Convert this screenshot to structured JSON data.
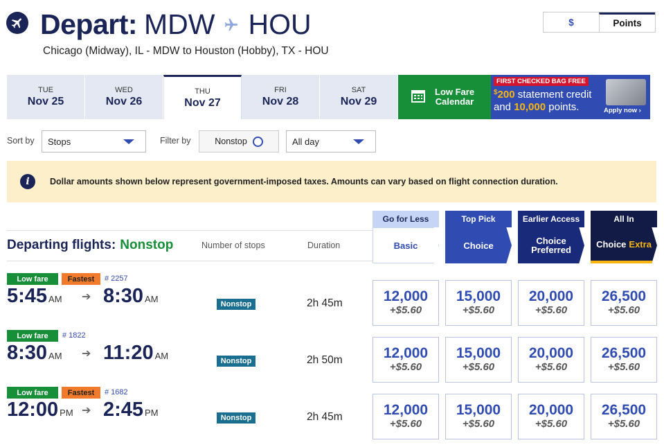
{
  "header": {
    "title_prefix": "Depart:",
    "origin": "MDW",
    "destination": "HOU",
    "route": "Chicago (Midway), IL - MDW to Houston (Hobby), TX - HOU",
    "currency_toggle": {
      "usd": "$",
      "points": "Points",
      "selected": "Points"
    }
  },
  "dates": [
    {
      "dow": "TUE",
      "day": "Nov 25",
      "active": false
    },
    {
      "dow": "WED",
      "day": "Nov 26",
      "active": false
    },
    {
      "dow": "THU",
      "day": "Nov 27",
      "active": true
    },
    {
      "dow": "FRI",
      "day": "Nov 28",
      "active": false
    },
    {
      "dow": "SAT",
      "day": "Nov 29",
      "active": false
    }
  ],
  "low_fare_calendar": {
    "line1": "Low Fare",
    "line2": "Calendar"
  },
  "promo": {
    "tag": "FIRST CHECKED BAG FREE",
    "dollar": "$",
    "amount1": "200",
    "line1_rest": " statement credit",
    "line2_pre": "and ",
    "amount2": "10,000",
    "line2_rest": " points.",
    "apply": "Apply now ›"
  },
  "controls": {
    "sort_label": "Sort by",
    "sort_value": "Stops",
    "filter_label": "Filter by",
    "nonstop_label": "Nonstop",
    "time_value": "All day"
  },
  "info": {
    "icon": "i",
    "text": "Dollar amounts shown below represent government-imposed taxes. Amounts can vary based on flight connection duration."
  },
  "list_header": {
    "title": "Departing flights:",
    "filter": "Nonstop",
    "col_stops": "Number of stops",
    "col_duration": "Duration"
  },
  "fare_families": [
    {
      "top": "Go for Less",
      "bottom": "Basic",
      "bottom_extra": ""
    },
    {
      "top": "Top Pick",
      "bottom": "Choice",
      "bottom_extra": ""
    },
    {
      "top": "Earlier Access",
      "bottom": "Choice Preferred",
      "bottom_extra": ""
    },
    {
      "top": "All In",
      "bottom": "Choice",
      "bottom_extra": "Extra"
    }
  ],
  "flights": [
    {
      "badges": [
        "Low fare",
        "Fastest"
      ],
      "flight_no": "# 2257",
      "depart": "5:45",
      "depart_ap": "AM",
      "arrive": "8:30",
      "arrive_ap": "AM",
      "stops": "Nonstop",
      "duration": "2h 45m",
      "fares": [
        {
          "points": "12,000",
          "tax": "+$5.60"
        },
        {
          "points": "15,000",
          "tax": "+$5.60"
        },
        {
          "points": "20,000",
          "tax": "+$5.60"
        },
        {
          "points": "26,500",
          "tax": "+$5.60"
        }
      ]
    },
    {
      "badges": [
        "Low fare"
      ],
      "flight_no": "# 1822",
      "depart": "8:30",
      "depart_ap": "AM",
      "arrive": "11:20",
      "arrive_ap": "AM",
      "stops": "Nonstop",
      "duration": "2h 50m",
      "fares": [
        {
          "points": "12,000",
          "tax": "+$5.60"
        },
        {
          "points": "15,000",
          "tax": "+$5.60"
        },
        {
          "points": "20,000",
          "tax": "+$5.60"
        },
        {
          "points": "26,500",
          "tax": "+$5.60"
        }
      ]
    },
    {
      "badges": [
        "Low fare",
        "Fastest"
      ],
      "flight_no": "# 1682",
      "depart": "12:00",
      "depart_ap": "PM",
      "arrive": "2:45",
      "arrive_ap": "PM",
      "stops": "Nonstop",
      "duration": "2h 45m",
      "fares": [
        {
          "points": "12,000",
          "tax": "+$5.60"
        },
        {
          "points": "15,000",
          "tax": "+$5.60"
        },
        {
          "points": "20,000",
          "tax": "+$5.60"
        },
        {
          "points": "26,500",
          "tax": "+$5.60"
        }
      ]
    }
  ]
}
